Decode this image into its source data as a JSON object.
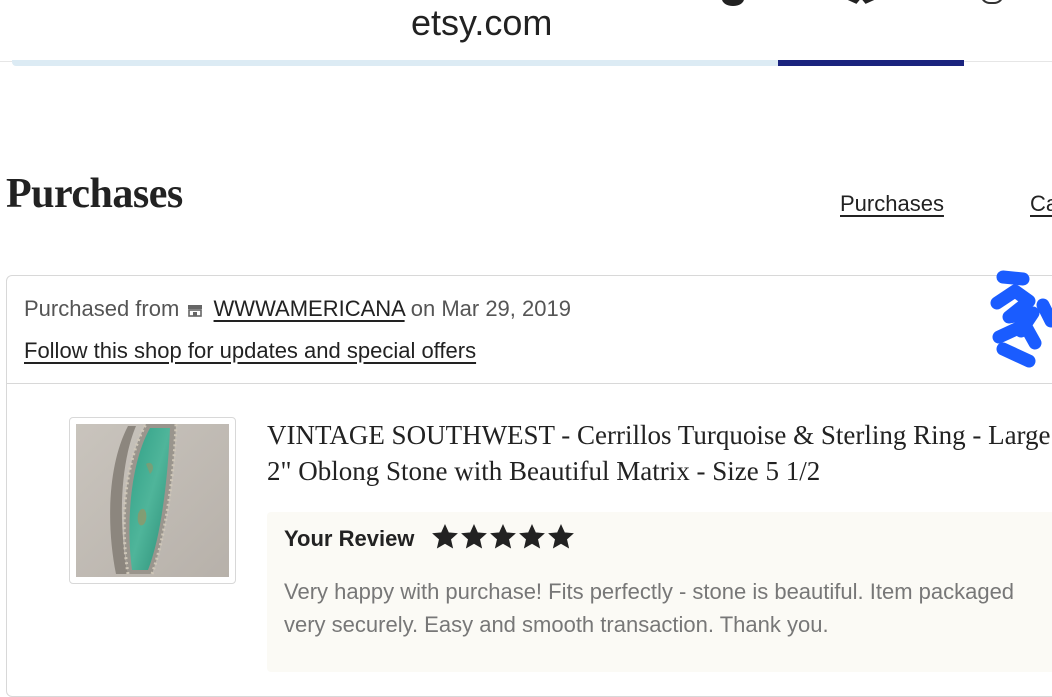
{
  "browser": {
    "url": "etsy.com",
    "page_load_progress": 1.0
  },
  "page": {
    "title": "Purchases",
    "nav": {
      "purchases_label": "Purchases",
      "second_label": "Ca"
    }
  },
  "order": {
    "purchased_from_prefix": "Purchased from",
    "shop_name": "WWWAMERICANA",
    "date_text": "on Mar 29, 2019",
    "follow_link": "Follow this shop for updates and special offers",
    "shop_icon": "shop-icon",
    "item": {
      "title": "VINTAGE SOUTHWEST - Cerrillos Turquoise & Sterling Ring - Large 2\" Oblong Stone with Beautiful Matrix - Size 5 1/2",
      "image_alt_icon": "turquoise-ring-thumbnail"
    },
    "review": {
      "label": "Your Review",
      "rating": 5,
      "rating_max": 5,
      "star_color": "#222222",
      "text": "Very happy with purchase! Fits perfectly - stone is beautiful. Item packaged very securely. Easy and smooth transaction. Thank you."
    }
  },
  "colors": {
    "progress_track": "#dcebf4",
    "progress_fill": "#1a237e",
    "scribble": "#1a5cff",
    "review_bg": "#fbfaf5"
  }
}
